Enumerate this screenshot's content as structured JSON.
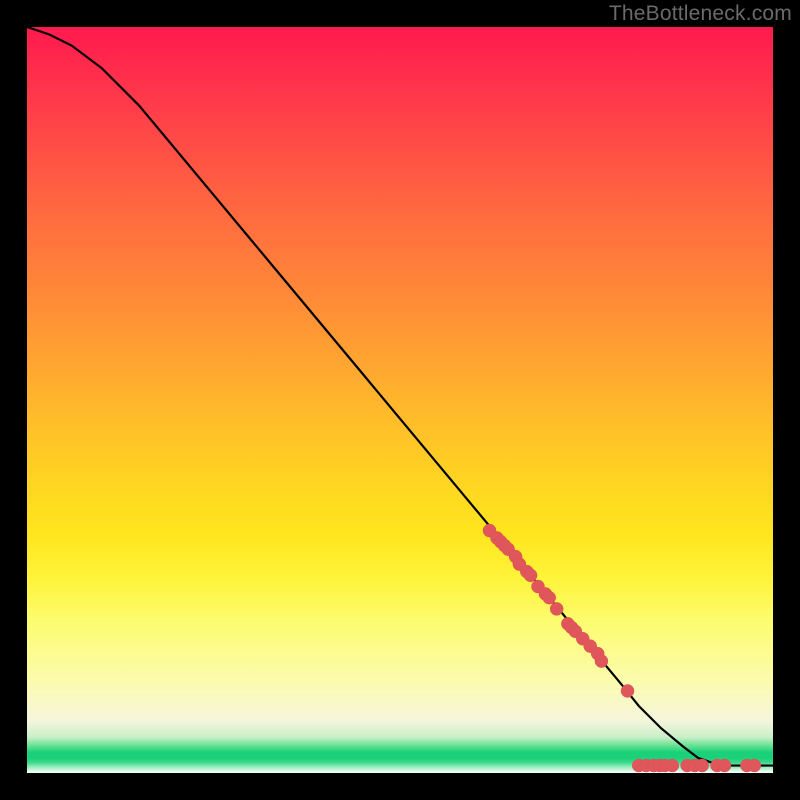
{
  "watermark": "TheBottleneck.com",
  "colors": {
    "background": "#000000",
    "curve": "#000000",
    "dots": "#e0575b",
    "gradient_top": "#ff1a4e",
    "gradient_mid": "#ffe61e",
    "gradient_green": "#1ad17a"
  },
  "chart_data": {
    "type": "line",
    "title": "",
    "xlabel": "",
    "ylabel": "",
    "xlim": [
      0,
      100
    ],
    "ylim": [
      0,
      100
    ],
    "x": [
      0,
      3,
      6,
      10,
      15,
      20,
      25,
      30,
      35,
      40,
      45,
      50,
      55,
      60,
      65,
      70,
      75,
      80,
      82,
      85,
      88,
      90,
      93,
      96,
      100
    ],
    "y": [
      100,
      99,
      97.5,
      94.5,
      89.5,
      83.5,
      77.5,
      71.5,
      65.5,
      59.5,
      53.5,
      47.5,
      41.5,
      35.5,
      29.5,
      23.5,
      17.5,
      11.5,
      9,
      6,
      3.5,
      2,
      1,
      1,
      1
    ],
    "series": [
      {
        "name": "scatter-points",
        "type": "scatter",
        "points": [
          {
            "x": 62,
            "y": 32.5
          },
          {
            "x": 63,
            "y": 31.5
          },
          {
            "x": 63.5,
            "y": 31
          },
          {
            "x": 64,
            "y": 30.5
          },
          {
            "x": 64.5,
            "y": 30
          },
          {
            "x": 65.5,
            "y": 29
          },
          {
            "x": 66,
            "y": 28
          },
          {
            "x": 67,
            "y": 27
          },
          {
            "x": 67.5,
            "y": 26.5
          },
          {
            "x": 68.5,
            "y": 25
          },
          {
            "x": 69.5,
            "y": 24
          },
          {
            "x": 70,
            "y": 23.5
          },
          {
            "x": 71,
            "y": 22
          },
          {
            "x": 72.5,
            "y": 20
          },
          {
            "x": 73,
            "y": 19.5
          },
          {
            "x": 73.5,
            "y": 19
          },
          {
            "x": 74.5,
            "y": 18
          },
          {
            "x": 75.5,
            "y": 17
          },
          {
            "x": 76.5,
            "y": 16
          },
          {
            "x": 77,
            "y": 15
          },
          {
            "x": 80.5,
            "y": 11
          },
          {
            "x": 82,
            "y": 1
          },
          {
            "x": 83,
            "y": 1
          },
          {
            "x": 84,
            "y": 1
          },
          {
            "x": 84.8,
            "y": 1
          },
          {
            "x": 85.5,
            "y": 1
          },
          {
            "x": 86.5,
            "y": 1
          },
          {
            "x": 88.5,
            "y": 1
          },
          {
            "x": 89.5,
            "y": 1
          },
          {
            "x": 90.5,
            "y": 1
          },
          {
            "x": 92.5,
            "y": 1
          },
          {
            "x": 93.5,
            "y": 1
          },
          {
            "x": 96.5,
            "y": 1
          },
          {
            "x": 97.5,
            "y": 1
          }
        ]
      }
    ]
  }
}
